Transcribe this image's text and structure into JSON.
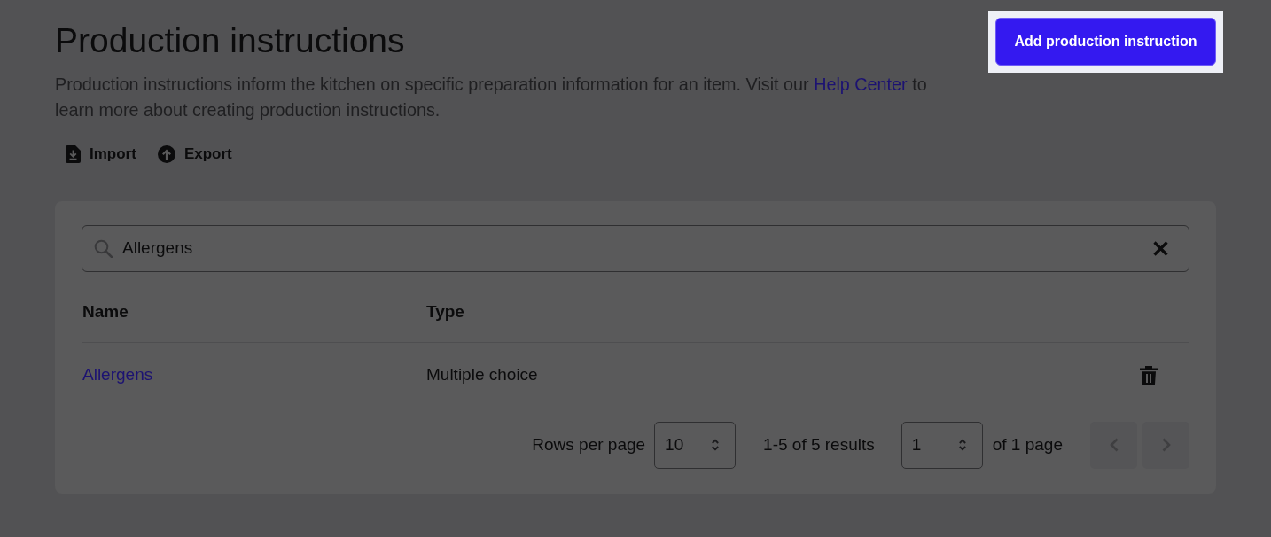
{
  "header": {
    "title": "Production instructions",
    "description": {
      "before": "Production instructions inform the kitchen on specific preparation information for an item. Visit our ",
      "link": "Help Center",
      "after": " to learn more about creating production instructions."
    },
    "add_button": {
      "label": "Add production instruction",
      "highlighted": true
    }
  },
  "actions": [
    {
      "kind": "import",
      "label": "Import"
    },
    {
      "kind": "export",
      "label": "Export"
    }
  ],
  "search": {
    "value": "Allergens"
  },
  "table": {
    "columns": [
      "Name",
      "Type"
    ],
    "rows": [
      {
        "name": "Allergens",
        "type": "Multiple choice"
      }
    ]
  },
  "pagination": {
    "rows_per_page_label": "Rows per page",
    "rows_per_page": "10",
    "results": "1-5 of 5 results",
    "page": "1",
    "page_count": "of 1 page",
    "previous": {
      "disabled": true
    },
    "next": {
      "disabled": true
    }
  }
}
